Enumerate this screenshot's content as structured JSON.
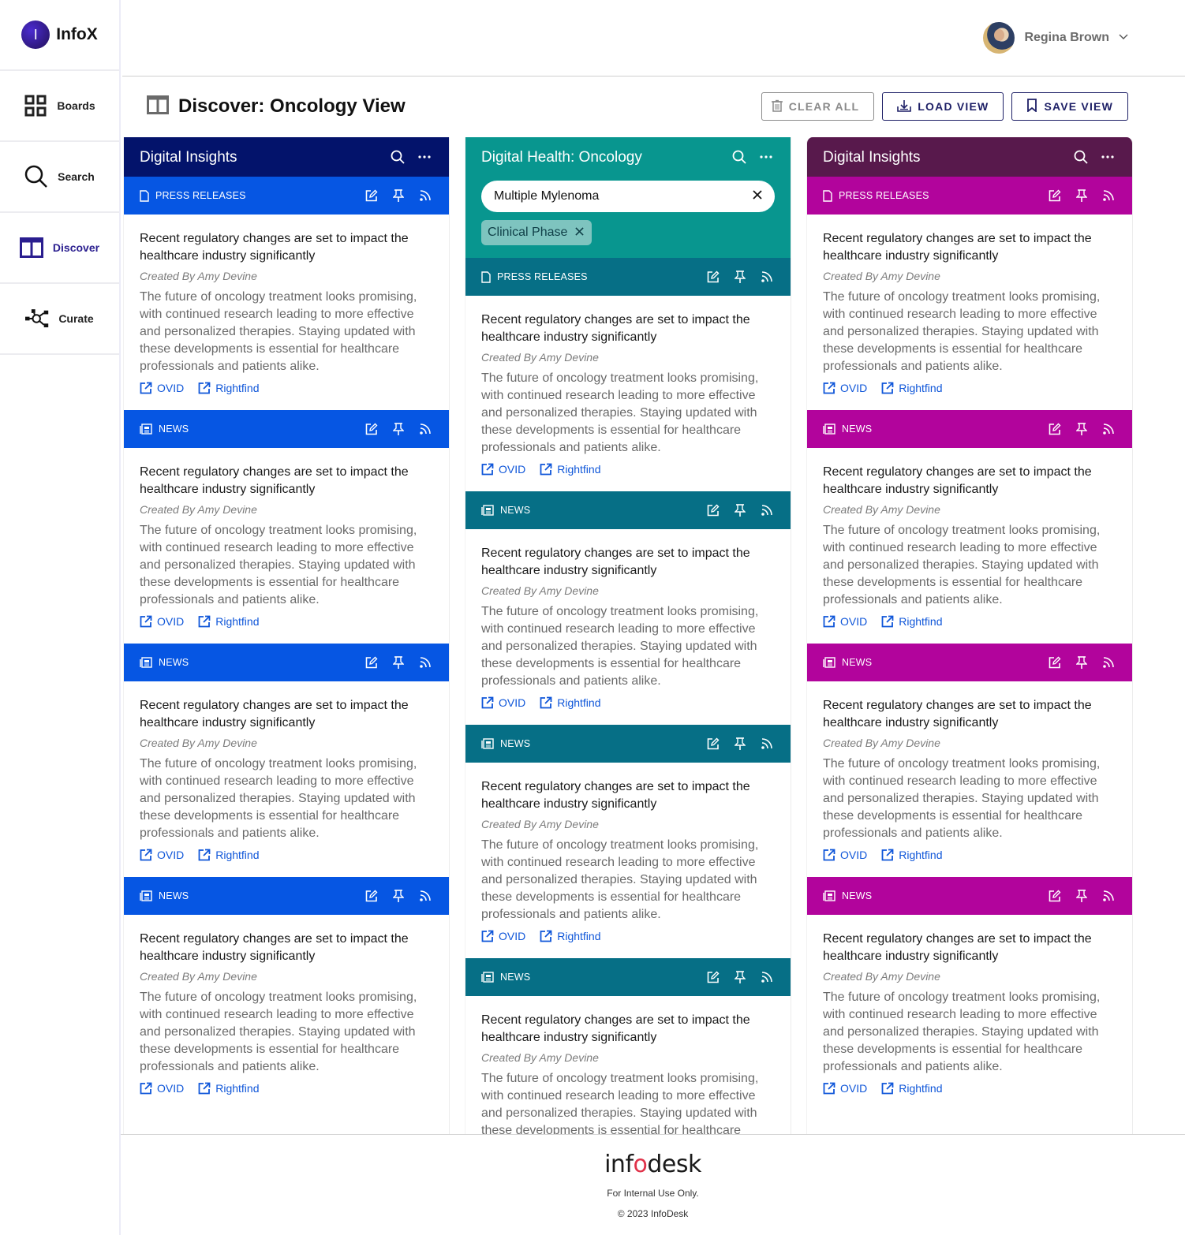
{
  "brand": {
    "logo_letter": "I",
    "name": "InfoX"
  },
  "sidebar": {
    "items": [
      {
        "label": "Boards",
        "icon": "grid-icon",
        "active": false
      },
      {
        "label": "Search",
        "icon": "search-icon",
        "active": false
      },
      {
        "label": "Discover",
        "icon": "columns-icon",
        "active": true
      },
      {
        "label": "Curate",
        "icon": "network-icon",
        "active": false
      }
    ]
  },
  "user": {
    "name": "Regina Brown"
  },
  "page": {
    "title_bold": "Discover:",
    "title_rest": " Oncology View",
    "actions": {
      "clear_all": "CLEAR ALL",
      "load_view": "LOAD VIEW",
      "save_view": "SAVE VIEW"
    }
  },
  "colors": {
    "col1_header": "#03136b",
    "col1_section": "#0656e3",
    "col2_header": "#08968f",
    "col2_section": "#066f86",
    "col3_header": "#58194c",
    "col3_section": "#b2049c",
    "link": "#0f56d9",
    "active_nav": "#2a1e8f"
  },
  "columns": [
    {
      "title": "Digital Insights",
      "sections": [
        {
          "type": "PRESS RELEASES",
          "icon": "document-icon"
        },
        {
          "type": "NEWS",
          "icon": "newspaper-icon"
        },
        {
          "type": "NEWS",
          "icon": "newspaper-icon"
        },
        {
          "type": "NEWS",
          "icon": "newspaper-icon"
        }
      ]
    },
    {
      "title": "Digital Health: Oncology",
      "search_value": "Multiple Mylenoma",
      "chip": "Clinical Phase",
      "sections": [
        {
          "type": "PRESS RELEASES",
          "icon": "document-icon"
        },
        {
          "type": "NEWS",
          "icon": "newspaper-icon"
        },
        {
          "type": "NEWS",
          "icon": "newspaper-icon"
        },
        {
          "type": "NEWS",
          "icon": "newspaper-icon"
        }
      ]
    },
    {
      "title": "Digital Insights",
      "sections": [
        {
          "type": "PRESS RELEASES",
          "icon": "document-icon"
        },
        {
          "type": "NEWS",
          "icon": "newspaper-icon"
        },
        {
          "type": "NEWS",
          "icon": "newspaper-icon"
        },
        {
          "type": "NEWS",
          "icon": "newspaper-icon"
        }
      ]
    }
  ],
  "article": {
    "headline": "Recent regulatory changes are set to impact the healthcare industry significantly",
    "author": "Created By Amy Devine",
    "body": "The future of oncology treatment looks promising, with continued research leading to more effective and personalized therapies. Staying updated with these developments is essential for healthcare professionals and patients alike.",
    "links": [
      "OVID",
      "Rightfind"
    ]
  },
  "footer": {
    "logo_pre": "inf",
    "logo_o": "o",
    "logo_post": "desk",
    "note": "For Internal Use Only.",
    "copyright": "© 2023 InfoDesk"
  }
}
